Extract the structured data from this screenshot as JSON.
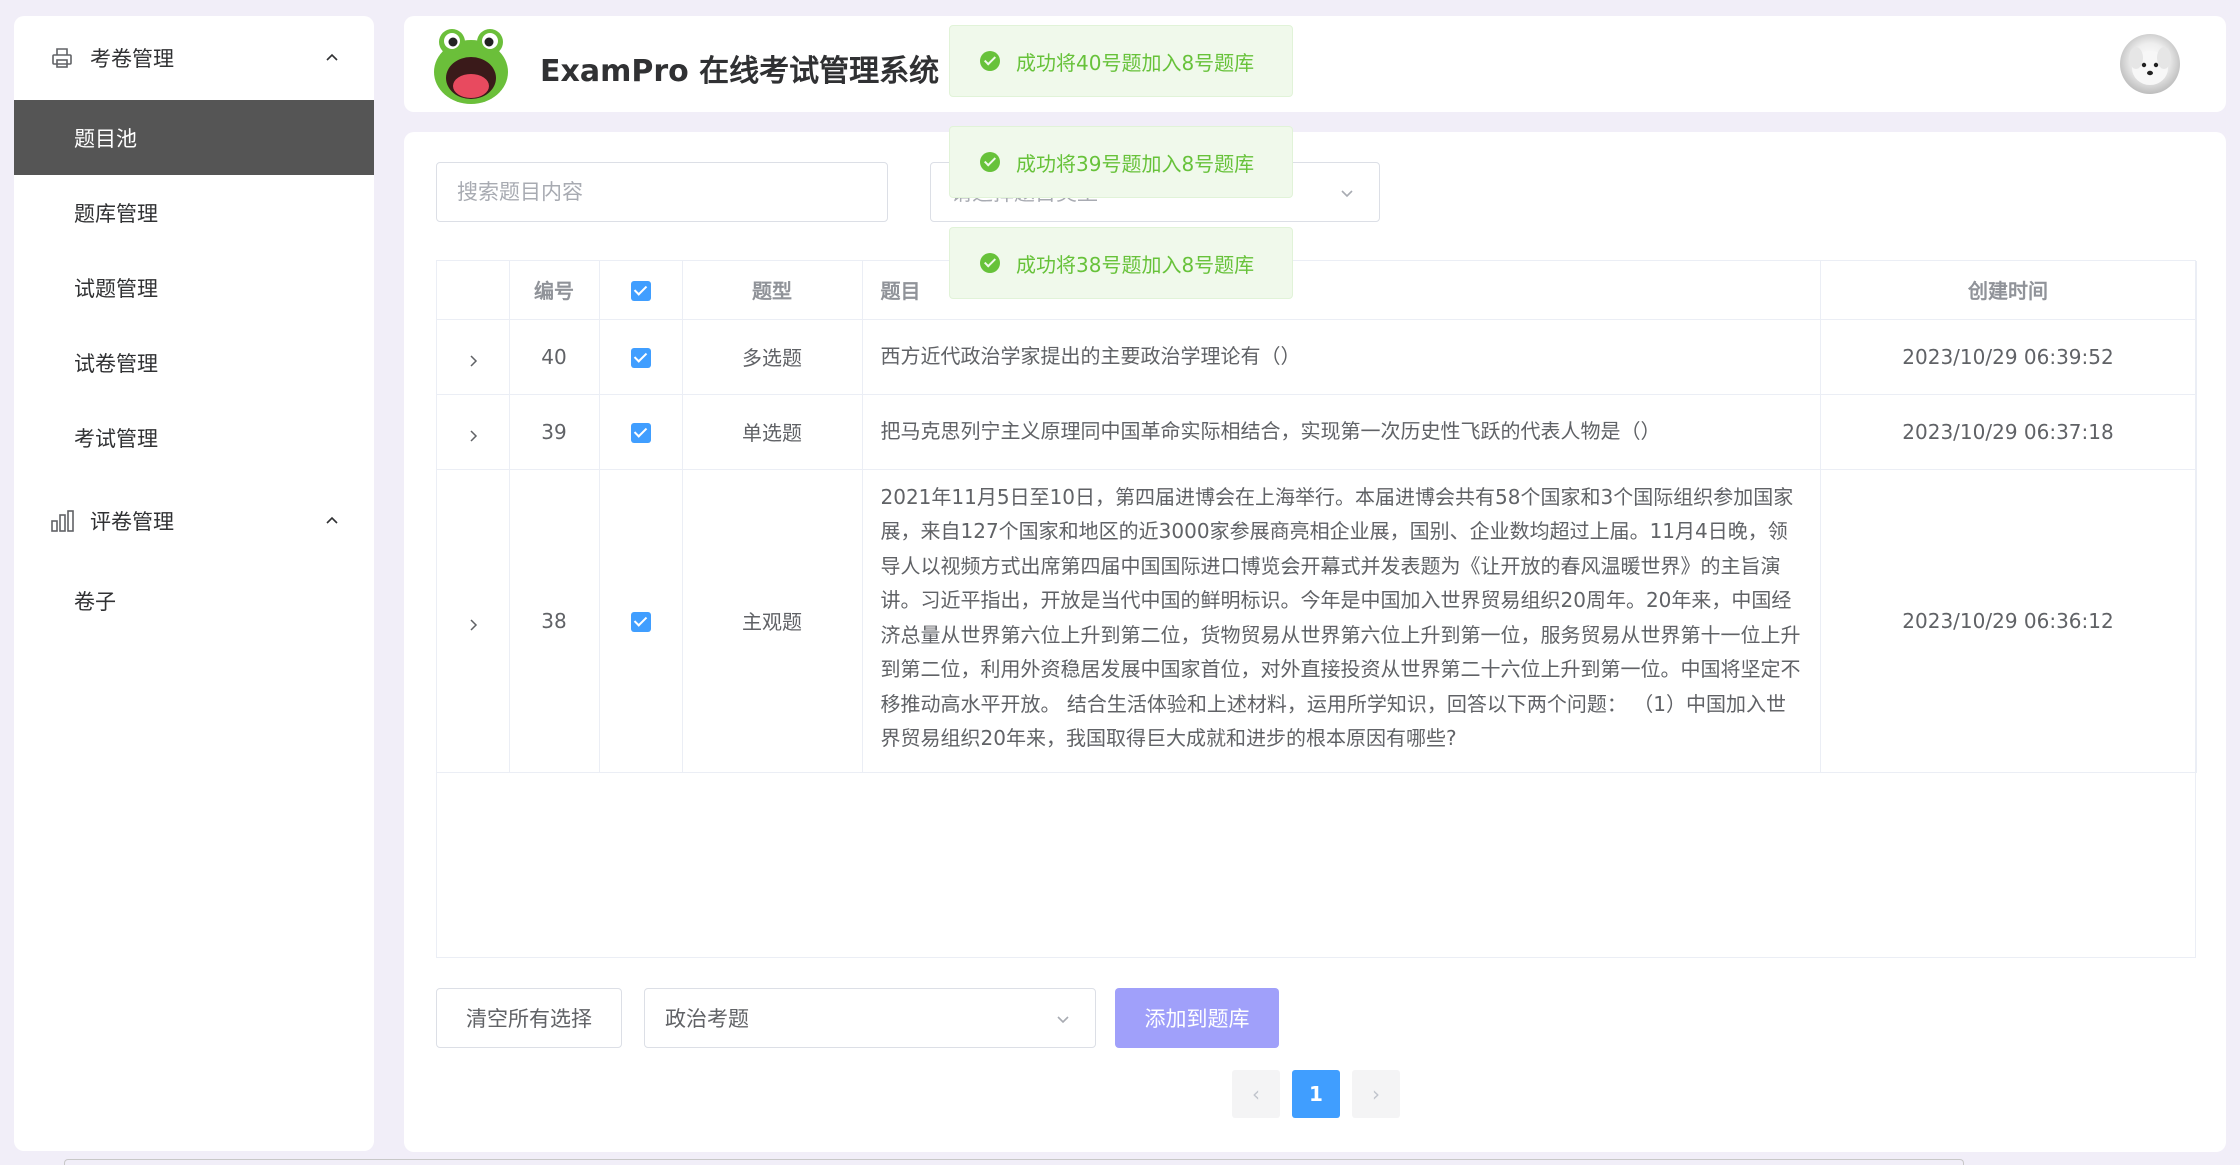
{
  "sidebar": {
    "group1": {
      "label": "考卷管理",
      "icon": "printer-icon"
    },
    "items": [
      {
        "label": "题目池",
        "active": true
      },
      {
        "label": "题库管理"
      },
      {
        "label": "试题管理"
      },
      {
        "label": "试卷管理"
      },
      {
        "label": "考试管理"
      }
    ],
    "group2": {
      "label": "评卷管理",
      "icon": "bar-chart-icon"
    },
    "items2": [
      {
        "label": "卷子"
      }
    ]
  },
  "header": {
    "title": "ExamPro 在线考试管理系统",
    "logo": "frog-logo",
    "avatar": "user-avatar"
  },
  "filters": {
    "search_placeholder": "搜索题目内容",
    "type_placeholder": "请选择题目类型"
  },
  "table": {
    "headers": {
      "id": "编号",
      "type": "题型",
      "question": "题目",
      "created": "创建时间"
    },
    "rows": [
      {
        "id": "40",
        "checked": true,
        "type": "多选题",
        "question": "西方近代政治学家提出的主要政治学理论有（）",
        "created": "2023/10/29 06:39:52"
      },
      {
        "id": "39",
        "checked": true,
        "type": "单选题",
        "question": "把马克思列宁主义原理同中国革命实际相结合，实现第一次历史性飞跃的代表人物是（）",
        "created": "2023/10/29 06:37:18"
      },
      {
        "id": "38",
        "checked": true,
        "type": "主观题",
        "question": "2021年11月5日至10日，第四届进博会在上海举行。本届进博会共有58个国家和3个国际组织参加国家展，来自127个国家和地区的近3000家参展商亮相企业展，国别、企业数均超过上届。11月4日晚，领导人以视频方式出席第四届中国国际进口博览会开幕式并发表题为《让开放的春风温暖世界》的主旨演讲。习近平指出，开放是当代中国的鲜明标识。今年是中国加入世界贸易组织20周年。20年来，中国经济总量从世界第六位上升到第二位，货物贸易从世界第六位上升到第一位，服务贸易从世界第十一位上升到第二位，利用外资稳居发展中国家首位，对外直接投资从世界第二十六位上升到第一位。中国将坚定不移推动高水平开放。 结合生活体验和上述材料，运用所学知识，回答以下两个问题： （1）中国加入世界贸易组织20年来，我国取得巨大成就和进步的根本原因有哪些?",
        "created": "2023/10/29 06:36:12"
      }
    ]
  },
  "actions": {
    "clear_label": "清空所有选择",
    "bank_value": "政治考题",
    "add_label": "添加到题库"
  },
  "pagination": {
    "current": "1",
    "prev": "‹",
    "next": "›"
  },
  "toasts": [
    {
      "text": "成功将40号题加入8号题库"
    },
    {
      "text": "成功将39号题加入8号题库"
    },
    {
      "text": "成功将38号题加入8号题库"
    }
  ],
  "colors": {
    "primary": "#409eff",
    "success": "#67c23a",
    "active_menu": "#555555",
    "add_button": "#a0a0fa"
  }
}
